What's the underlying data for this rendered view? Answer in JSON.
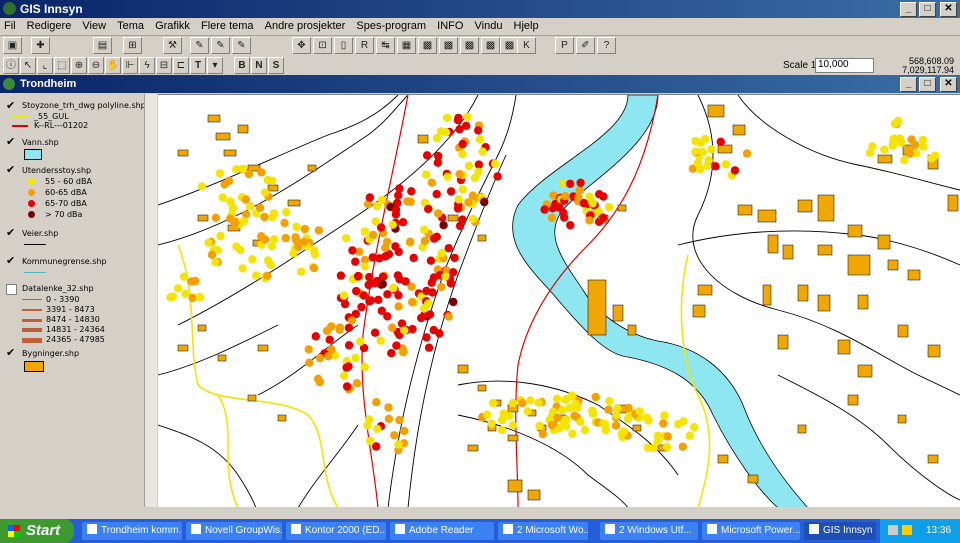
{
  "app": {
    "title": "GIS Innsyn",
    "window_buttons": [
      "_",
      "□",
      "✕"
    ]
  },
  "menu": [
    "Fil",
    "Redigere",
    "View",
    "Tema",
    "Grafikk",
    "Flere tema",
    "Andre prosjekter",
    "Spes-program",
    "INFO",
    "Vindu",
    "Hjelp"
  ],
  "toolbar1": {
    "letter_buttons": [
      "R",
      "K",
      "P"
    ]
  },
  "toolbar2": {
    "text_buttons": [
      "T",
      "B",
      "N",
      "S"
    ],
    "scale_label": "Scale 1:",
    "scale_value": "10,000",
    "coord_x": "568,608.09",
    "coord_y": "7,029,117.94"
  },
  "document": {
    "title": "Trondheim"
  },
  "legend": {
    "layers": [
      {
        "name": "Stoyzone_trh_dwg polyline.shp",
        "checked": true,
        "items": [
          {
            "label": "_55_GUL",
            "color": "#f2e600"
          },
          {
            "label": "K--RL---01202",
            "color": "#e00000"
          }
        ]
      },
      {
        "name": "Vann.shp",
        "checked": true,
        "items": [
          {
            "label": "",
            "color": "#8ee6f0"
          }
        ]
      },
      {
        "name": "Utendersstoy.shp",
        "checked": true,
        "items": [
          {
            "label": "55 - 60 dBA",
            "color": "#f5e400"
          },
          {
            "label": "60-65 dBA",
            "color": "#f5a000"
          },
          {
            "label": "65-70 dBA",
            "color": "#e60000"
          },
          {
            "label": "> 70 dBa",
            "color": "#7a0000"
          }
        ]
      },
      {
        "name": "Veier.shp",
        "checked": true,
        "items": [
          {
            "label": "",
            "color": "#000000"
          }
        ]
      },
      {
        "name": "Kommunegrense.shp",
        "checked": true,
        "items": [
          {
            "label": "",
            "color": "#4fb8c0"
          }
        ]
      },
      {
        "name": "Datalenke_32.shp",
        "checked": false,
        "items": [
          {
            "label": "0 - 3390",
            "color": "#c0603a"
          },
          {
            "label": "3391 - 8473",
            "color": "#c0603a"
          },
          {
            "label": "8474 - 14830",
            "color": "#c0603a"
          },
          {
            "label": "14831 - 24364",
            "color": "#c0603a"
          },
          {
            "label": "24365 - 47985",
            "color": "#c0603a"
          }
        ]
      },
      {
        "name": "Bygninger.shp",
        "checked": true,
        "items": [
          {
            "label": "",
            "color": "#f0a800"
          }
        ]
      }
    ]
  },
  "taskbar": {
    "start": "Start",
    "tasks": [
      "Trondheim komm...",
      "Novell GroupWis...",
      "Kontor 2000 (ED...",
      "Adobe Reader",
      "2 Microsoft Wo...",
      "2 Windows Utf...",
      "Microsoft Power...",
      "GIS Innsyn"
    ],
    "clock": "13:36"
  },
  "colors": {
    "water": "#8ee6f0",
    "building": "#f0a800",
    "road": "#000000",
    "red_line": "#e00000",
    "yellow_line": "#f5e400"
  }
}
